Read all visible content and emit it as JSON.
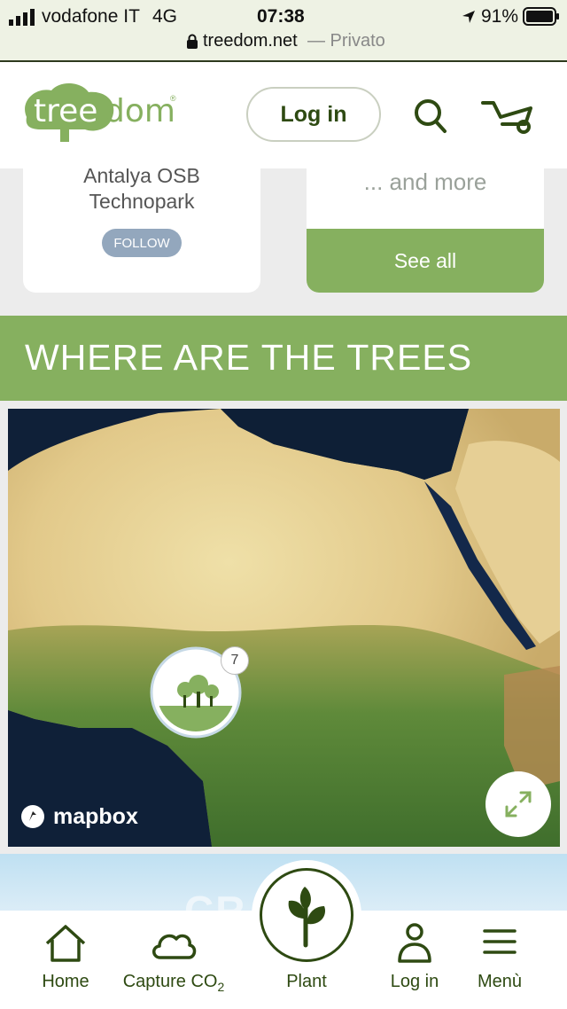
{
  "status_bar": {
    "carrier": "vodafone IT",
    "network": "4G",
    "time": "07:38",
    "battery": "91%",
    "url": "treedom.net",
    "privacy": "— Privato"
  },
  "header": {
    "logo": "treedom",
    "login_label": "Log in"
  },
  "cards": {
    "company_name_line1": "Antalya OSB",
    "company_name_line2": "Technopark",
    "follow_label": "FOLLOW",
    "more_text": "... and more",
    "see_all_label": "See all"
  },
  "section": {
    "title": "WHERE ARE THE TREES"
  },
  "map": {
    "cluster_count": "7",
    "attribution": "mapbox"
  },
  "promo": {
    "partial_text": "CR"
  },
  "tabbar": {
    "home": "Home",
    "capture_prefix": "Capture CO",
    "capture_sub": "2",
    "plant": "Plant",
    "login": "Log in",
    "menu": "Menù"
  },
  "colors": {
    "brand_green": "#86b05f",
    "dark_green": "#2e4a12"
  }
}
